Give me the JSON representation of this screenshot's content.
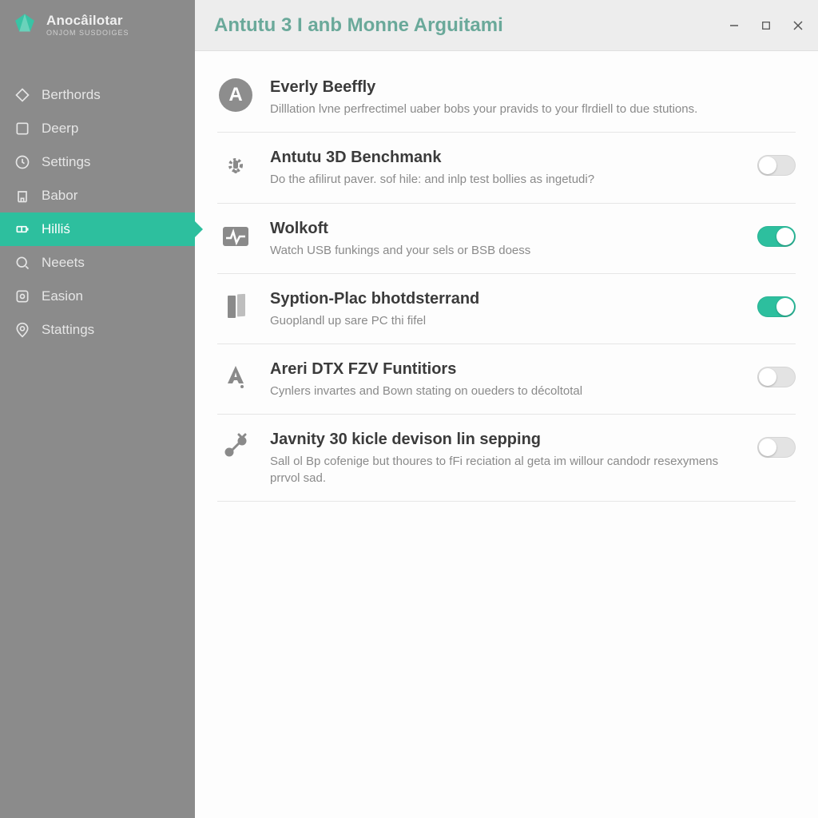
{
  "brand": {
    "title": "Anocâilotar",
    "subtitle": "ONJOM SUSDOIGES"
  },
  "sidebar": {
    "items": [
      {
        "label": "Berthords",
        "active": false
      },
      {
        "label": "Deerp",
        "active": false
      },
      {
        "label": "Settings",
        "active": false
      },
      {
        "label": "Babor",
        "active": false
      },
      {
        "label": "Hilliś",
        "active": true
      },
      {
        "label": "Neeets",
        "active": false
      },
      {
        "label": "Easion",
        "active": false
      },
      {
        "label": "Stattings",
        "active": false
      }
    ]
  },
  "header": {
    "title": "Antutu 3 I anb Monne Arguitami"
  },
  "settings": [
    {
      "icon": "badge-a",
      "title": "Everly Beeffly",
      "desc": "Dilllation lvne perfrectimel uaber bobs your pravids to your flrdiell to due stutions.",
      "toggle": null
    },
    {
      "icon": "gear-dots",
      "title": "Antutu 3D Benchmank",
      "desc": "Do the afilirut paver. sof hile: and inlp test bollies as ingetudi?",
      "toggle": false
    },
    {
      "icon": "activity",
      "title": "Wolkoft",
      "desc": "Watch USB funkings and your sels or BSB doess",
      "toggle": true
    },
    {
      "icon": "panel",
      "title": "Syption-Plac bhotdsterrand",
      "desc": "Guoplandl up sare PC thi fifel",
      "toggle": true
    },
    {
      "icon": "a-dot",
      "title": "Areri DTX FZV Funtitiors",
      "desc": "Cynlers invartes and Bown stating on oueders to décoltotal",
      "toggle": false
    },
    {
      "icon": "share-nodes",
      "title": "Javnity 30 kicle devison lin sepping",
      "desc": "Sall ol Bp cofenige but thoures to fFi reciation al geta im willour candodr resexymens prrvol sad.",
      "toggle": false
    }
  ],
  "colors": {
    "accent": "#2dbf9e",
    "sidebar_bg": "#8b8b8b",
    "title": "#6aa99a"
  }
}
